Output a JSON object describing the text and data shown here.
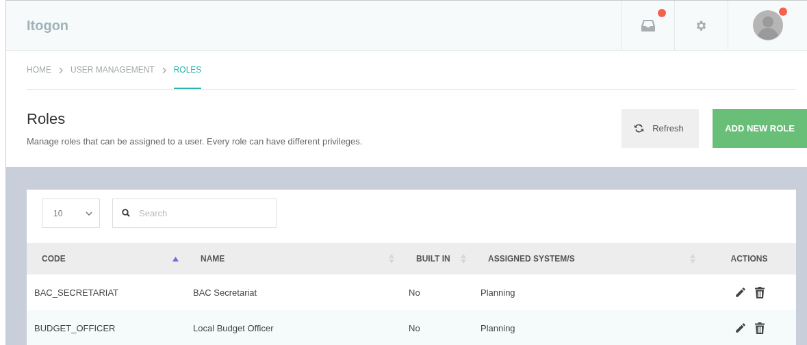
{
  "header": {
    "brand": "Itogon",
    "inbox_badge": true,
    "avatar_badge": true
  },
  "breadcrumb": [
    {
      "label": "HOME",
      "selected": false
    },
    {
      "label": "USER MANAGEMENT",
      "selected": false
    },
    {
      "label": "ROLES",
      "selected": true
    }
  ],
  "page": {
    "title": "Roles",
    "description": "Manage roles that can be assigned to a user. Every role can have different privileges.",
    "buttons": [
      {
        "kind": "refresh",
        "label": "Refresh"
      },
      {
        "kind": "primary",
        "label": "ADD NEW ROLE"
      }
    ]
  },
  "table": {
    "page_size": "10",
    "search": {
      "placeholder": "Search"
    },
    "columns": [
      {
        "label": "CODE",
        "sorted": true
      },
      {
        "label": "NAME",
        "sorted": false
      },
      {
        "label": "BUILT IN",
        "sorted": false
      },
      {
        "label": "ASSIGNED SYSTEM/S",
        "sorted": false
      },
      {
        "label": "ACTIONS"
      }
    ],
    "rows": [
      {
        "cells": [
          "BAC_SECRETARIAT",
          "BAC Secretariat",
          "No",
          "Planning"
        ]
      },
      {
        "cells": [
          "BUDGET_OFFICER",
          "Local Budget Officer",
          "No",
          "Planning"
        ]
      }
    ]
  }
}
